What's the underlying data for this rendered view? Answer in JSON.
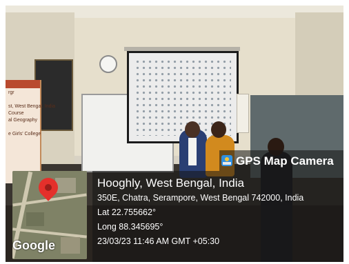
{
  "overlay": {
    "app_name": "GPS Map Camera",
    "location_title": "Hooghly, West Bengal, India",
    "address": "350E, Chatra, Serampore, West Bengal 742000, India",
    "latitude": "Lat 22.755662°",
    "longitude": "Long 88.345695°",
    "datetime": "23/03/23 11:46 AM GMT +05:30",
    "map_provider": "Google"
  },
  "banner": {
    "text": "rgr\n\nst, West Bengal, India\nCourse\nal Geography\n\ne Girls' College"
  },
  "colors": {
    "overlay_background": "#141414",
    "overlay_text": "#ffffff",
    "map_pin": "#e4302b",
    "app_icon": "#2f8fe0"
  }
}
